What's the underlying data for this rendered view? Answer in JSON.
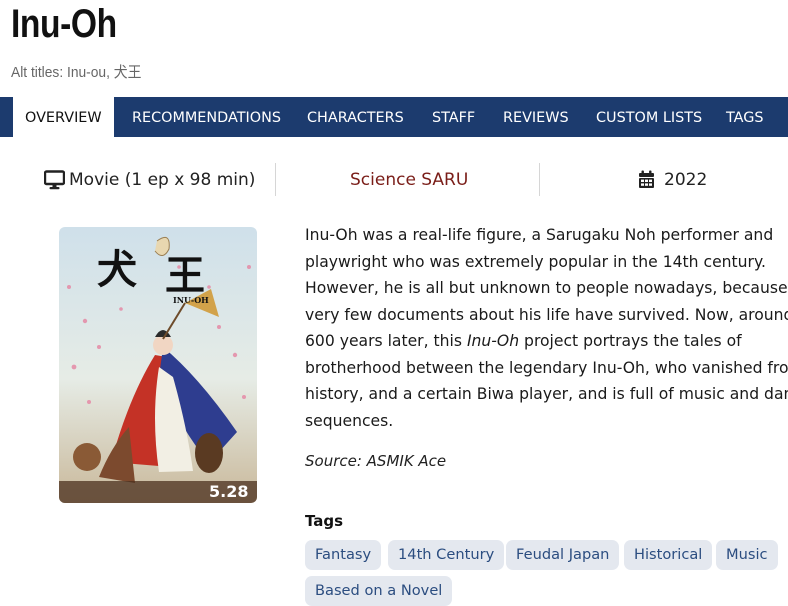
{
  "title": "Inu-Oh",
  "alt_titles": "Alt titles: Inu-ou, 犬王",
  "tabs": [
    {
      "label": "OVERVIEW",
      "active": true
    },
    {
      "label": "RECOMMENDATIONS"
    },
    {
      "label": "CHARACTERS"
    },
    {
      "label": "STAFF"
    },
    {
      "label": "REVIEWS"
    },
    {
      "label": "CUSTOM LISTS"
    },
    {
      "label": "TAGS"
    }
  ],
  "info": {
    "format": "Movie (1 ep x 98 min)",
    "studio": "Science SARU",
    "year": "2022"
  },
  "poster": {
    "title_kanji_1": "犬",
    "title_kanji_2": "王",
    "title_latin": "INU-OH",
    "release_date": "5.28"
  },
  "description": {
    "part1": "Inu-Oh was a real-life figure, a Sarugaku Noh performer and playwright who was extremely popular in the 14th century. However, he is all but unknown to people nowadays, because very few documents about his life have survived. Now, around 600 years later, this ",
    "italic": "Inu-Oh",
    "part2": " project portrays the tales of brotherhood between the legendary Inu-Oh, who vanished from history, and a certain Biwa player, and is full of music and dance sequences."
  },
  "source": "Source: ASMIK Ace",
  "tags_label": "Tags",
  "tags": [
    "Fantasy",
    "14th Century",
    "Feudal Japan",
    "Historical",
    "Music",
    "Based on a Novel"
  ],
  "colors": {
    "nav_bg": "#1c3b6e",
    "studio_link": "#7a1d18",
    "tag_bg": "#e4e8ef",
    "tag_text": "#2b4d80"
  },
  "icons": {
    "format": "monitor-icon",
    "year": "calendar-icon"
  }
}
